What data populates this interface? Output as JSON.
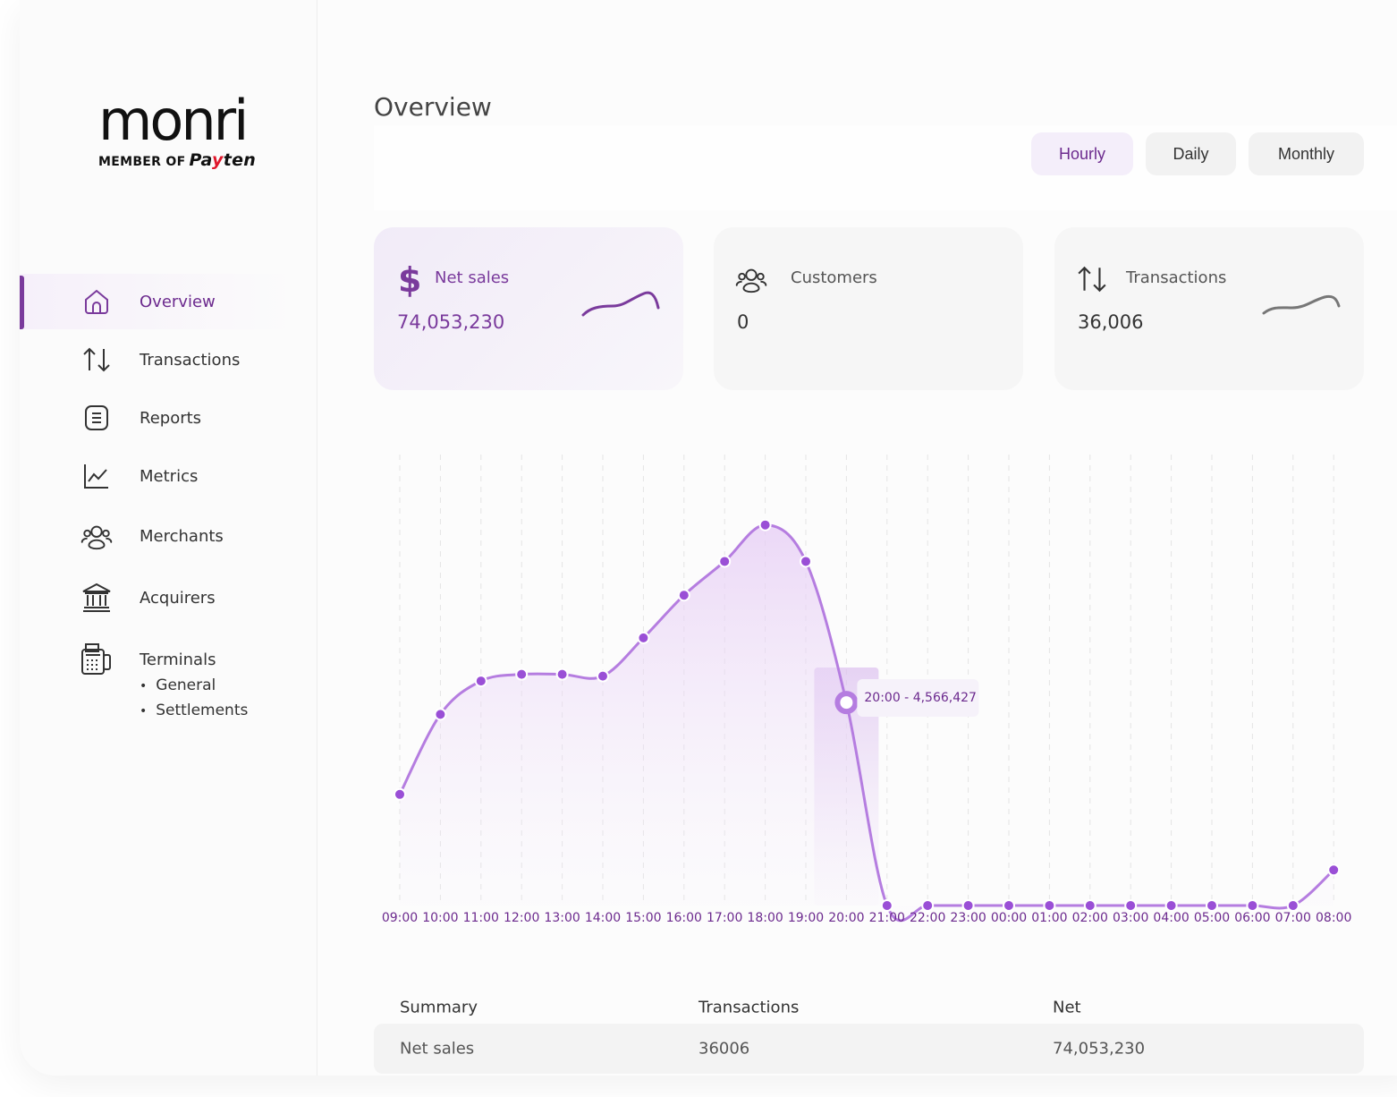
{
  "brand": {
    "wordmark": "monri",
    "member_of": "MEMBER OF",
    "payten_pa": "Pa",
    "payten_y": "y",
    "payten_ten": "ten",
    "accent": "#7a3a9c",
    "line_color": "#b57de0"
  },
  "sidebar": {
    "items": [
      {
        "label": "Overview",
        "icon": "home-icon",
        "active": true
      },
      {
        "label": "Transactions",
        "icon": "arrows-up-down-icon"
      },
      {
        "label": "Reports",
        "icon": "document-icon"
      },
      {
        "label": "Metrics",
        "icon": "line-chart-icon"
      },
      {
        "label": "Merchants",
        "icon": "users-icon"
      },
      {
        "label": "Acquirers",
        "icon": "bank-icon"
      },
      {
        "label": "Terminals",
        "icon": "pos-terminal-icon"
      }
    ],
    "terminal_subitems": [
      "General",
      "Settlements"
    ]
  },
  "main": {
    "title": "Overview",
    "ranges": [
      {
        "label": "Hourly",
        "active": true
      },
      {
        "label": "Daily"
      },
      {
        "label": "Monthly"
      }
    ]
  },
  "cards": [
    {
      "label": "Net sales",
      "value": "74,053,230",
      "icon": "dollar-icon",
      "active": true
    },
    {
      "label": "Customers",
      "value": "0",
      "icon": "users-icon"
    },
    {
      "label": "Transactions",
      "value": "36,006",
      "icon": "arrows-up-down-icon"
    }
  ],
  "chart_data": {
    "type": "area",
    "categories": [
      "09:00",
      "10:00",
      "11:00",
      "12:00",
      "13:00",
      "14:00",
      "15:00",
      "16:00",
      "17:00",
      "18:00",
      "19:00",
      "20:00",
      "21:00",
      "22:00",
      "23:00",
      "00:00",
      "01:00",
      "02:00",
      "03:00",
      "04:00",
      "05:00",
      "06:00",
      "07:00",
      "08:00"
    ],
    "series": [
      {
        "values": [
          2500000,
          4300000,
          5050000,
          5200000,
          5200000,
          5160000,
          6020000,
          6980000,
          7740000,
          8560000,
          7740000,
          4566427,
          0,
          0,
          0,
          0,
          0,
          0,
          0,
          0,
          0,
          0,
          0,
          800000
        ]
      }
    ],
    "highlight": {
      "index": 11,
      "label": "20:00 - 4,566,427"
    },
    "ylim": [
      0,
      9500000
    ],
    "grid": "vertical-dashed"
  },
  "summary": {
    "headers": [
      "Summary",
      "Transactions",
      "Net"
    ],
    "rows": [
      [
        "Net sales",
        "36006",
        "74,053,230"
      ]
    ]
  }
}
